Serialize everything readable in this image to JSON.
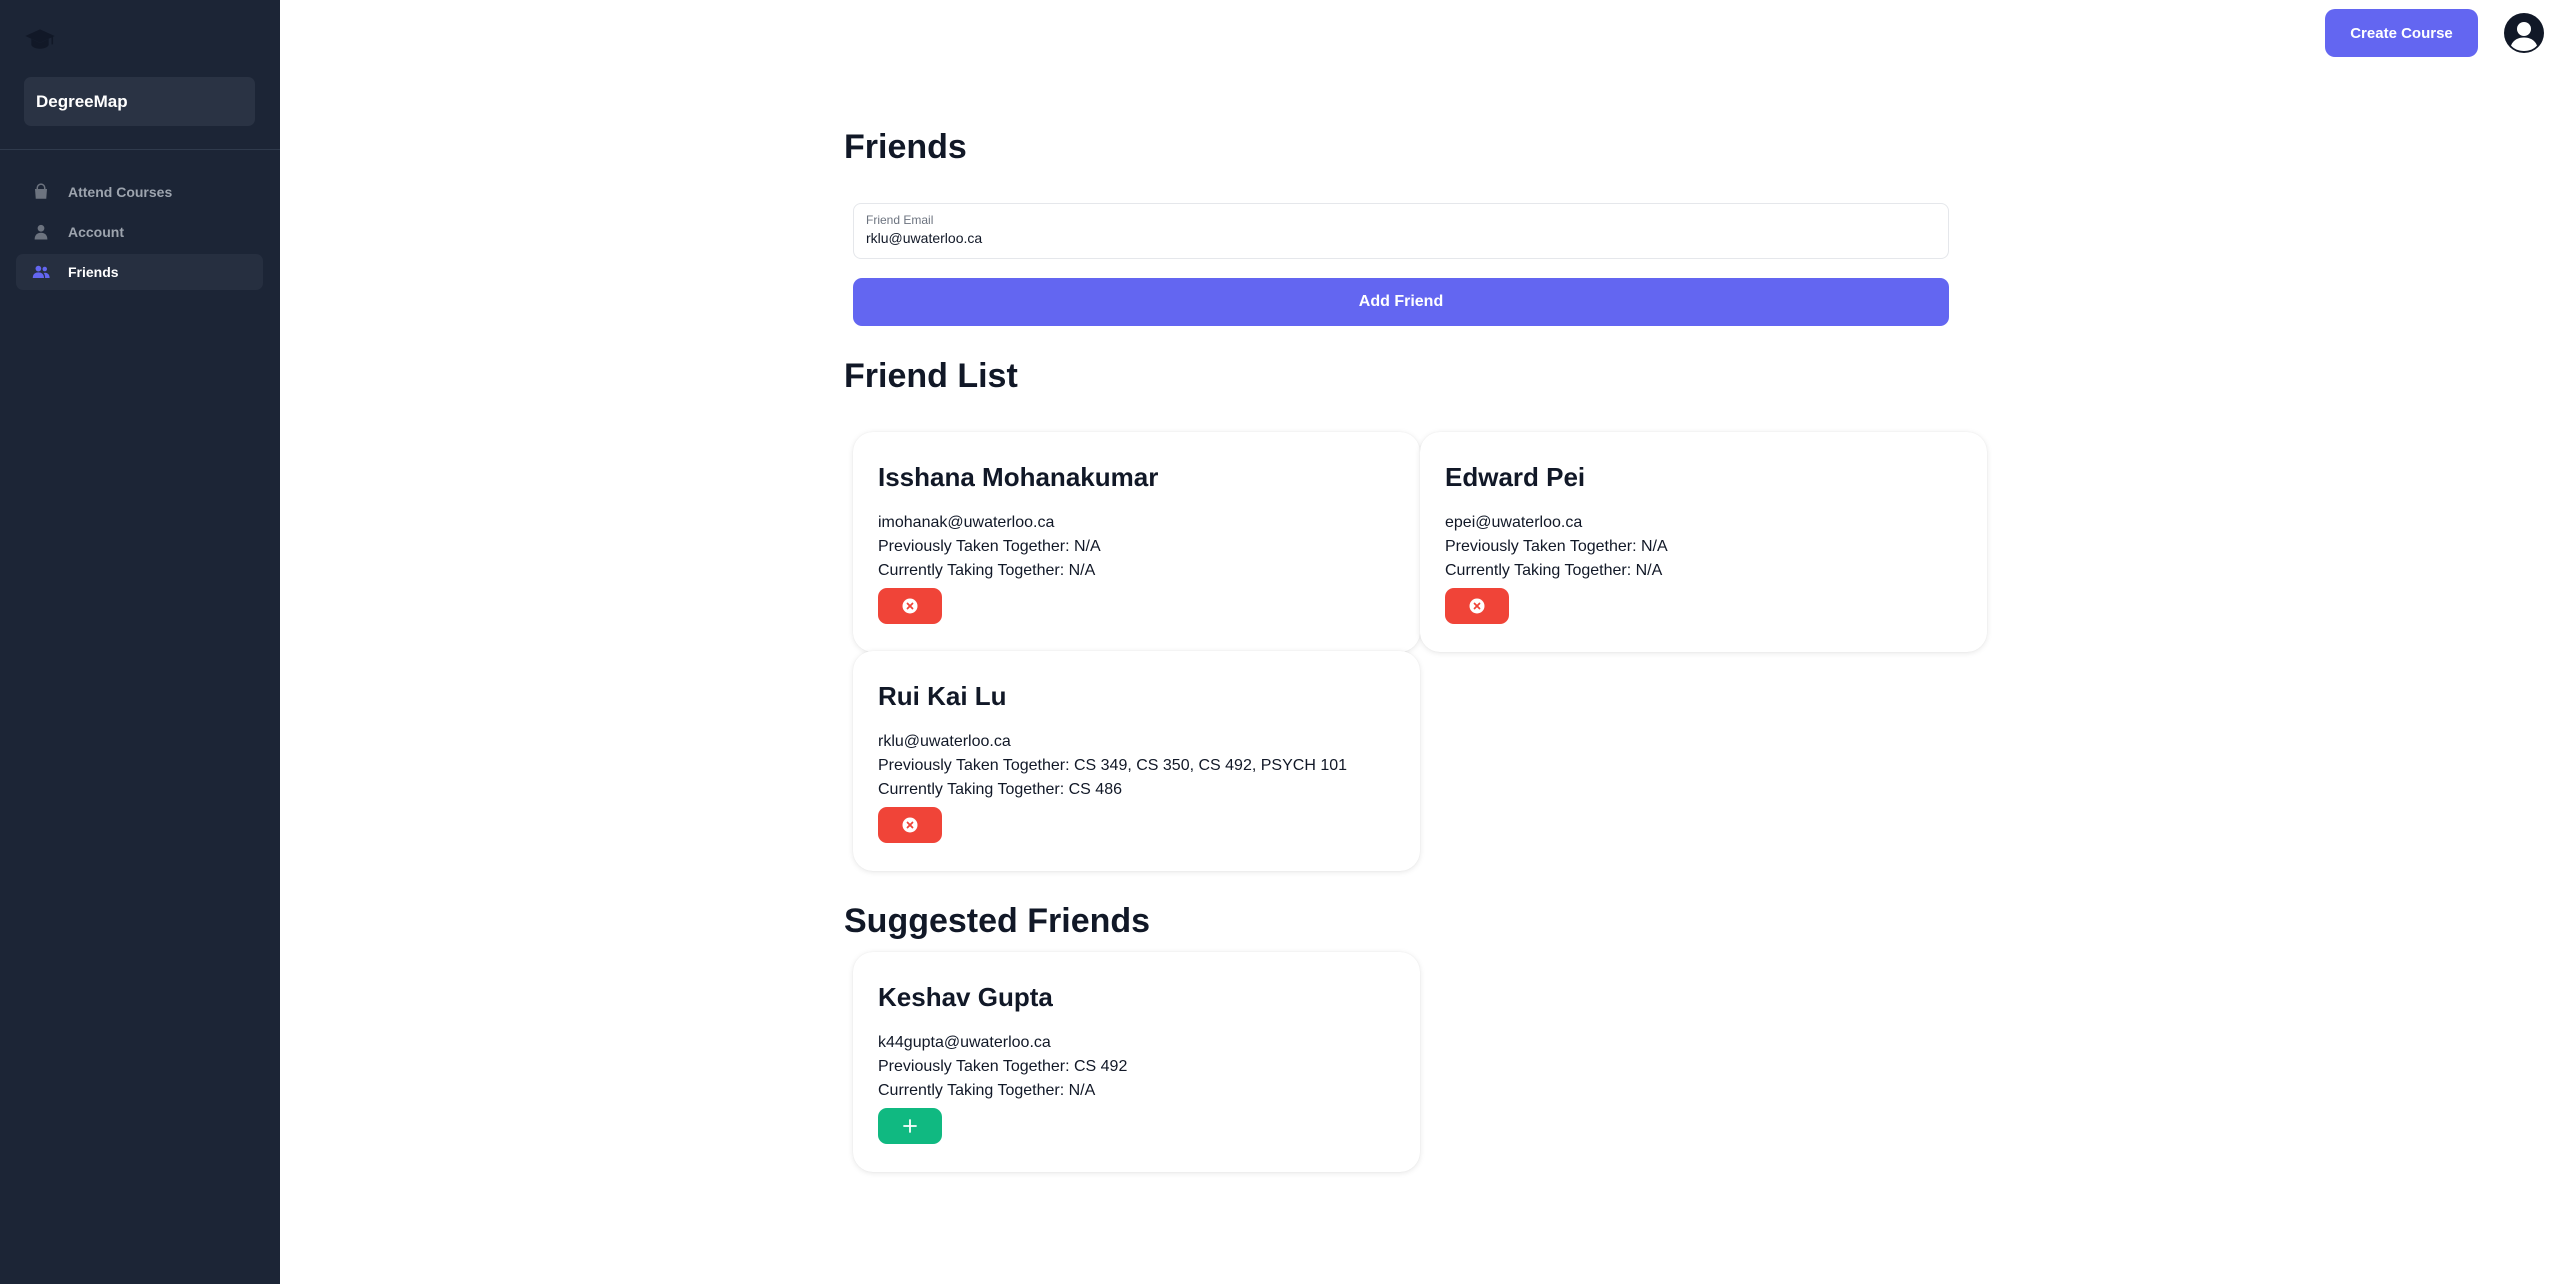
{
  "sidebar": {
    "brand": "DegreeMap",
    "items": [
      {
        "label": "Attend Courses",
        "icon": "shopping-bag-icon",
        "active": false
      },
      {
        "label": "Account",
        "icon": "user-icon",
        "active": false
      },
      {
        "label": "Friends",
        "icon": "users-icon",
        "active": true
      }
    ]
  },
  "topbar": {
    "create_course_label": "Create Course"
  },
  "main": {
    "title": "Friends",
    "email_field": {
      "label": "Friend Email",
      "value": "rklu@uwaterloo.ca"
    },
    "add_friend_label": "Add Friend",
    "friend_list_title": "Friend List",
    "friends": [
      {
        "name": "Isshana Mohanakumar",
        "email": "imohanak@uwaterloo.ca",
        "previously": "Previously Taken Together: N/A",
        "currently": "Currently Taking Together: N/A"
      },
      {
        "name": "Edward Pei",
        "email": "epei@uwaterloo.ca",
        "previously": "Previously Taken Together: N/A",
        "currently": "Currently Taking Together: N/A"
      },
      {
        "name": "Rui Kai Lu",
        "email": "rklu@uwaterloo.ca",
        "previously": "Previously Taken Together: CS 349, CS 350, CS 492, PSYCH 101",
        "currently": "Currently Taking Together: CS 486"
      }
    ],
    "suggested_title": "Suggested Friends",
    "suggested": [
      {
        "name": "Keshav Gupta",
        "email": "k44gupta@uwaterloo.ca",
        "previously": "Previously Taken Together: CS 492",
        "currently": "Currently Taking Together: N/A"
      }
    ]
  },
  "colors": {
    "sidebar_bg": "#1c2536",
    "primary": "#6366f1",
    "danger": "#f04438",
    "success": "#10b981"
  }
}
